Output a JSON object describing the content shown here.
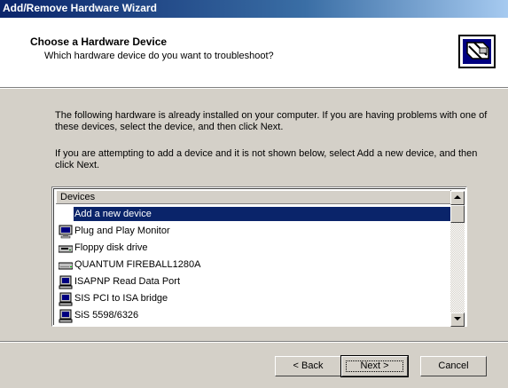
{
  "window": {
    "title": "Add/Remove Hardware Wizard"
  },
  "header": {
    "title": "Choose a Hardware Device",
    "subtitle": "Which hardware device do you want to troubleshoot?",
    "icon": "hardware-wizard-icon"
  },
  "body": {
    "paragraph1": "The following hardware is already installed on your computer. If you are having problems with one of these devices, select the device, and then click Next.",
    "paragraph2": "If you are attempting to add a device and it is not shown below, select Add a new device, and then click Next."
  },
  "devices": {
    "column_header": "Devices",
    "selected_index": 0,
    "items": [
      {
        "label": "Add a new device",
        "icon": "none"
      },
      {
        "label": "Plug and Play Monitor",
        "icon": "monitor-icon"
      },
      {
        "label": "Floppy disk drive",
        "icon": "floppy-drive-icon"
      },
      {
        "label": "QUANTUM FIREBALL1280A",
        "icon": "hard-disk-icon"
      },
      {
        "label": "ISAPNP Read Data Port",
        "icon": "system-device-icon"
      },
      {
        "label": "SIS PCI to ISA bridge",
        "icon": "system-device-icon"
      },
      {
        "label": "SiS 5598/6326",
        "icon": "system-device-icon"
      }
    ]
  },
  "buttons": {
    "back": "< Back",
    "next": "Next >",
    "cancel": "Cancel"
  },
  "colors": {
    "title_bar": "#0a246a",
    "selection": "#0a246a",
    "face": "#d4d0c8"
  }
}
